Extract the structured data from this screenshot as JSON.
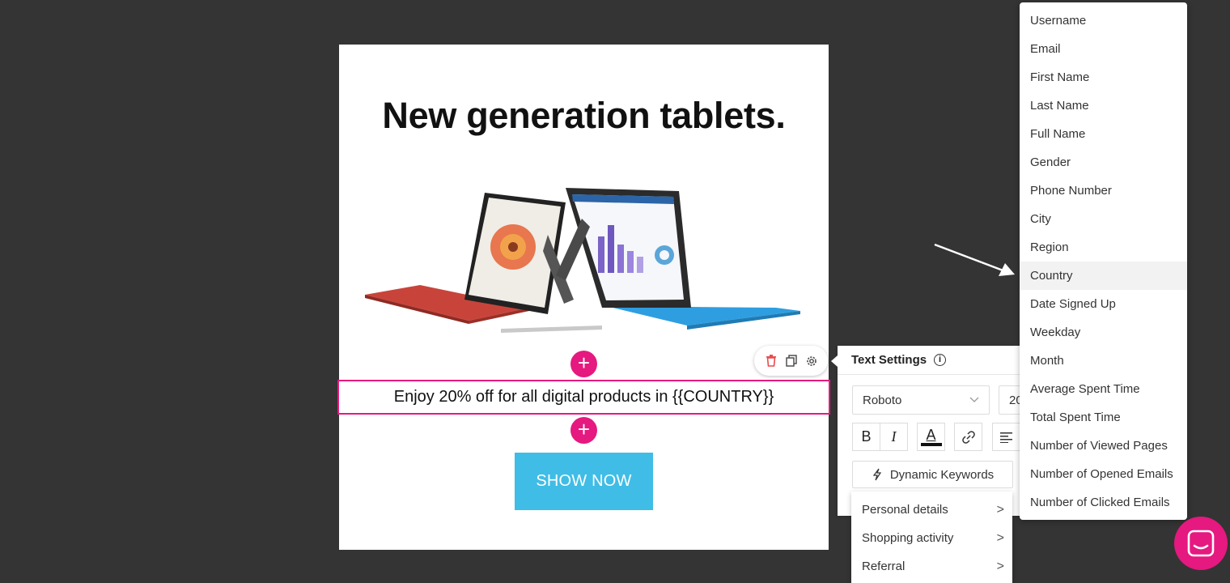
{
  "canvas": {
    "headline": "New generation tablets.",
    "image_alt": "Two tablets with keyboard covers",
    "text_block": "Enjoy 20% off for all digital products in {{COUNTRY}}",
    "cta_label": "SHOW NOW",
    "add_symbol": "+"
  },
  "block_toolbar": {
    "icons": [
      "trash-icon",
      "copy-icon",
      "gear-icon"
    ]
  },
  "text_settings": {
    "title": "Text Settings",
    "info_symbol": "i",
    "font": "Roboto",
    "size": "20",
    "bold": "B",
    "italic": "I",
    "color_letter": "A",
    "dynamic_keywords_label": "Dynamic Keywords"
  },
  "submenu": {
    "items": [
      "Personal details",
      "Shopping activity",
      "Referral"
    ],
    "arrow": ">"
  },
  "keywords": {
    "items": [
      "Username",
      "Email",
      "First Name",
      "Last Name",
      "Full Name",
      "Gender",
      "Phone Number",
      "City",
      "Region",
      "Country",
      "Date Signed Up",
      "Weekday",
      "Month",
      "Average Spent Time",
      "Total Spent Time",
      "Number of Viewed Pages",
      "Number of Opened Emails",
      "Number of Clicked Emails"
    ],
    "highlighted": "Country"
  },
  "colors": {
    "background": "#343434",
    "accent": "#e5197f",
    "cta": "#3fbde6"
  }
}
